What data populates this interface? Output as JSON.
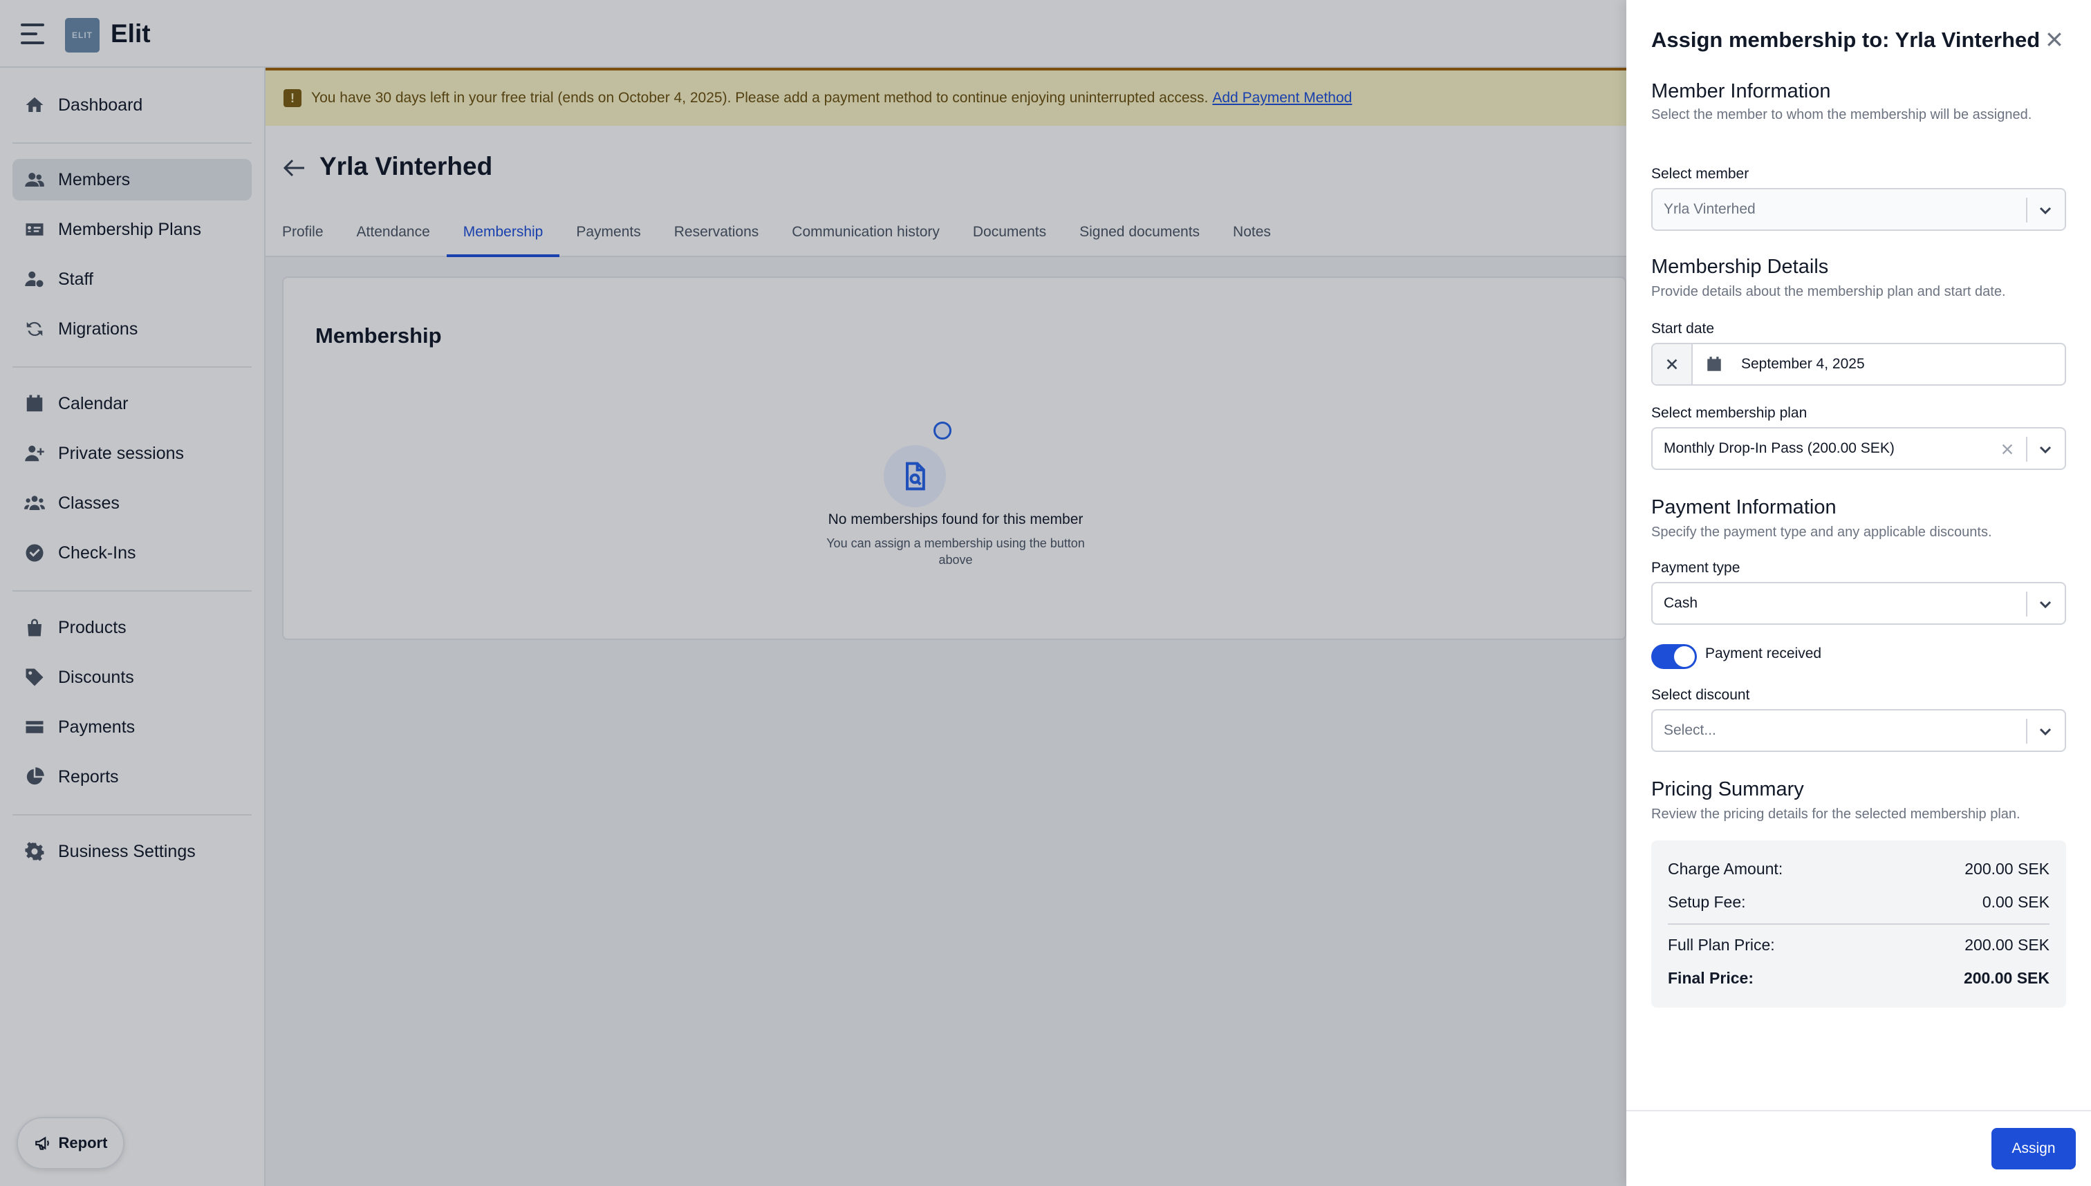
{
  "app": {
    "title": "Elit",
    "logo_text": "ELIT"
  },
  "sidebar": {
    "items": [
      {
        "label": "Dashboard",
        "icon": "home-icon"
      },
      {
        "label": "Members",
        "icon": "users-icon",
        "active": true
      },
      {
        "label": "Membership Plans",
        "icon": "id-card-icon"
      },
      {
        "label": "Staff",
        "icon": "user-gear-icon"
      },
      {
        "label": "Migrations",
        "icon": "refresh-icon"
      },
      {
        "label": "Calendar",
        "icon": "calendar-icon"
      },
      {
        "label": "Private sessions",
        "icon": "user-plus-icon"
      },
      {
        "label": "Classes",
        "icon": "group-icon"
      },
      {
        "label": "Check-Ins",
        "icon": "check-circle-icon"
      },
      {
        "label": "Products",
        "icon": "bag-icon"
      },
      {
        "label": "Discounts",
        "icon": "tag-icon"
      },
      {
        "label": "Payments",
        "icon": "credit-card-icon"
      },
      {
        "label": "Reports",
        "icon": "pie-chart-icon"
      },
      {
        "label": "Business Settings",
        "icon": "gear-icon"
      }
    ],
    "report_button": "Report"
  },
  "banner": {
    "text": "You have 30 days left in your free trial (ends on October 4, 2025). Please add a payment method to continue enjoying uninterrupted access.",
    "link": "Add Payment Method",
    "icon_glyph": "!"
  },
  "member": {
    "name": "Yrla Vinterhed",
    "tabs": [
      "Profile",
      "Attendance",
      "Membership",
      "Payments",
      "Reservations",
      "Communication history",
      "Documents",
      "Signed documents",
      "Notes"
    ],
    "active_tab": "Membership"
  },
  "membership_card": {
    "title": "Membership",
    "empty_title": "No memberships found for this member",
    "empty_sub": "You can assign a membership using the button above"
  },
  "drawer": {
    "title": "Assign membership to: Yrla Vinterhed",
    "member_info": {
      "title": "Member Information",
      "desc": "Select the member to whom the membership will be assigned.",
      "select_label": "Select member",
      "select_value": "Yrla Vinterhed"
    },
    "membership_details": {
      "title": "Membership Details",
      "desc": "Provide details about the membership plan and start date.",
      "start_label": "Start date",
      "start_value": "September 4, 2025",
      "plan_label": "Select membership plan",
      "plan_value": "Monthly Drop-In Pass (200.00 SEK)"
    },
    "payment_info": {
      "title": "Payment Information",
      "desc": "Specify the payment type and any applicable discounts.",
      "type_label": "Payment type",
      "type_value": "Cash",
      "received_label": "Payment received",
      "received": true,
      "discount_label": "Select discount",
      "discount_placeholder": "Select..."
    },
    "pricing": {
      "title": "Pricing Summary",
      "desc": "Review the pricing details for the selected membership plan.",
      "charge_label": "Charge Amount:",
      "charge_value": "200.00 SEK",
      "setup_label": "Setup Fee:",
      "setup_value": "0.00 SEK",
      "full_label": "Full Plan Price:",
      "full_value": "200.00 SEK",
      "final_label": "Final Price:",
      "final_value": "200.00 SEK"
    },
    "assign_button": "Assign"
  },
  "colors": {
    "accent": "#1d4ed8",
    "banner_bg": "#fdf6c8",
    "banner_border": "#a16207"
  }
}
